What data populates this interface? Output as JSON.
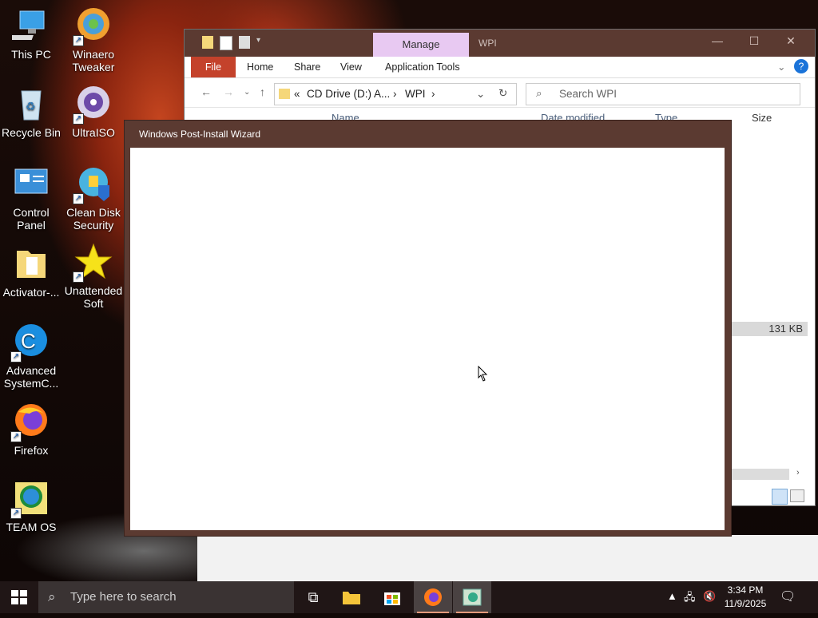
{
  "desktop": {
    "icons": [
      {
        "label": "This PC",
        "icon": "this-pc-icon"
      },
      {
        "label": "Winaero Tweaker",
        "icon": "winaero-tweaker-icon",
        "shortcut": true
      },
      {
        "label": "Recycle Bin",
        "icon": "recycle-bin-icon"
      },
      {
        "label": "UltraISO",
        "icon": "ultraiso-icon",
        "shortcut": true
      },
      {
        "label": "Control Panel",
        "icon": "control-panel-icon",
        "shortcut": true
      },
      {
        "label": "Clean Disk Security",
        "icon": "clean-disk-security-icon",
        "shortcut": true
      },
      {
        "label": "Activator-...",
        "icon": "folder-icon"
      },
      {
        "label": "Unattended Soft",
        "icon": "star-icon",
        "shortcut": true
      },
      {
        "label": "Advanced SystemC...",
        "icon": "advanced-systemcare-icon",
        "shortcut": true
      },
      {
        "label": "Firefox",
        "icon": "firefox-icon",
        "shortcut": true
      },
      {
        "label": "TEAM OS",
        "icon": "team-os-icon",
        "shortcut": true
      }
    ]
  },
  "explorer": {
    "title": "WPI",
    "manage_tab": "Manage",
    "tabs": {
      "file": "File",
      "home": "Home",
      "share": "Share",
      "view": "View",
      "app_tools": "Application Tools"
    },
    "address": {
      "prefix": "«",
      "segment1": "CD Drive (D:) A...",
      "sep": "›",
      "segment2": "WPI",
      "sep2": "›"
    },
    "search_placeholder": "Search WPI",
    "columns": {
      "name": "Name",
      "date": "Date modified",
      "type": "Type",
      "size": "Size"
    },
    "size_value": "131 KB",
    "colors": {
      "titlebar": "#5b3a31",
      "file_tab": "#c4422b",
      "manage_tab": "#e8c9f2"
    }
  },
  "wizard": {
    "title": "Windows Post-Install Wizard"
  },
  "taskbar": {
    "search_placeholder": "Type here to search",
    "time": "3:34 PM",
    "date": "11/9/2025"
  }
}
